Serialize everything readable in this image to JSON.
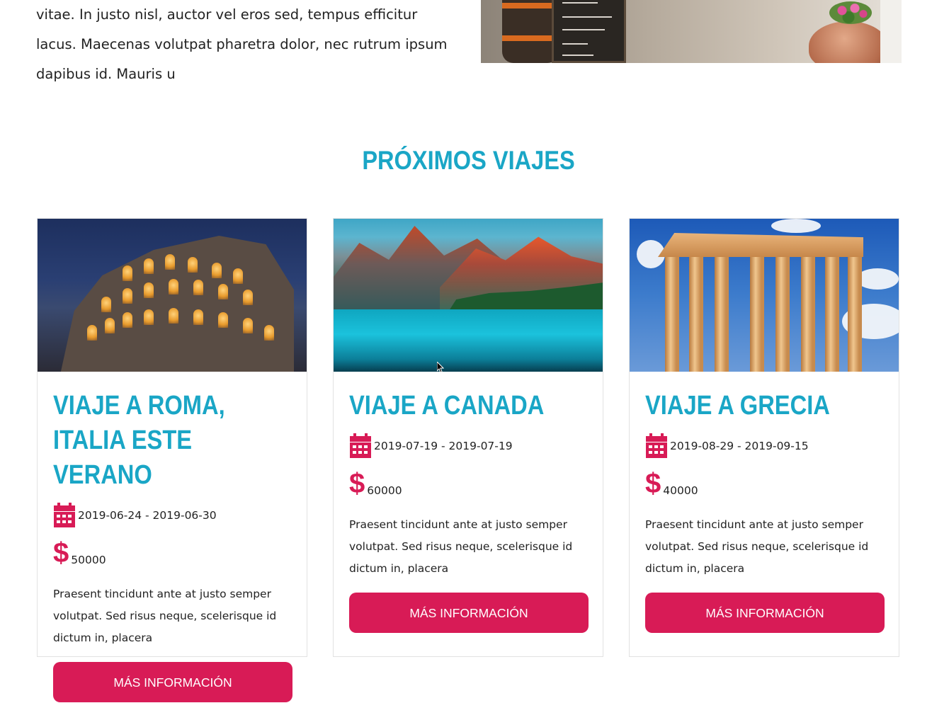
{
  "intro": {
    "lines": [
      "vitae. In justo nisl, auctor vel eros sed, tempus efficitur",
      "lacus. Maecenas volutpat pharetra dolor, nec rutrum ipsum",
      "dapibus id. Mauris u"
    ]
  },
  "section": {
    "title": "PRÓXIMOS VIAJES"
  },
  "trips": [
    {
      "title": "VIAJE A ROMA, ITALIA ESTE VERANO",
      "dates": "2019-06-24 - 2019-06-30",
      "price": "50000",
      "description": "Praesent tincidunt ante at justo semper volutpat. Sed risus neque, scelerisque id dictum in, placera",
      "button": "MÁS INFORMACIÓN"
    },
    {
      "title": "VIAJE A CANADA",
      "dates": "2019-07-19 - 2019-07-19",
      "price": "60000",
      "description": "Praesent tincidunt ante at justo semper volutpat. Sed risus neque, scelerisque id dictum in, placera",
      "button": "MÁS INFORMACIÓN"
    },
    {
      "title": "VIAJE A GRECIA",
      "dates": "2019-08-29 - 2019-09-15",
      "price": "40000",
      "description": "Praesent tincidunt ante at justo semper volutpat. Sed risus neque, scelerisque id dictum in, placera",
      "button": "MÁS INFORMACIÓN"
    }
  ],
  "icons": {
    "dates": "calendar-icon",
    "price": "dollar-icon",
    "dollar_glyph": "$"
  },
  "colors": {
    "accent_blue": "#1aa6c6",
    "accent_pink": "#d81b56"
  }
}
